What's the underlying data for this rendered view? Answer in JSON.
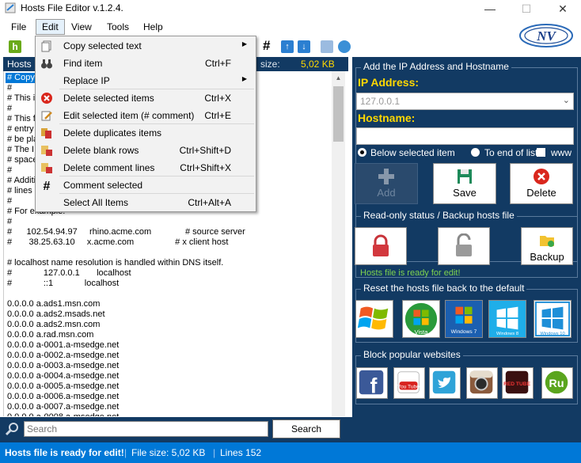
{
  "window": {
    "title": "Hosts File Editor v.1.2.4.",
    "minimize_glyph": "—",
    "maximize_glyph": "☐",
    "close_glyph": "✕"
  },
  "menubar": {
    "file": "File",
    "edit": "Edit",
    "view": "View",
    "tools": "Tools",
    "help": "Help"
  },
  "logo": {
    "text": "NV"
  },
  "edit_menu": {
    "items": [
      {
        "label": "Copy selected text",
        "shortcut": "",
        "submenu": true,
        "icon": "copy-icon"
      },
      {
        "label": "Find item",
        "shortcut": "Ctrl+F",
        "submenu": false,
        "icon": "binoculars-icon"
      },
      {
        "label": "Replace IP",
        "shortcut": "",
        "submenu": true,
        "icon": ""
      },
      {
        "label": "Delete selected items",
        "shortcut": "Ctrl+X",
        "submenu": false,
        "icon": "delete-icon"
      },
      {
        "label": "Edit selected item (# comment)",
        "shortcut": "Ctrl+E",
        "submenu": false,
        "icon": "edit-icon"
      },
      {
        "label": "Delete duplicates items",
        "shortcut": "",
        "submenu": false,
        "icon": "duplicates-icon"
      },
      {
        "label": "Delete blank rows",
        "shortcut": "Ctrl+Shift+D",
        "submenu": false,
        "icon": "blank-rows-icon"
      },
      {
        "label": "Delete comment lines",
        "shortcut": "Ctrl+Shift+X",
        "submenu": false,
        "icon": "comment-lines-icon"
      },
      {
        "label": "Comment selected",
        "shortcut": "",
        "submenu": false,
        "icon": "hash-icon"
      },
      {
        "label": "Select All Items",
        "shortcut": "Ctrl+Alt+A",
        "submenu": false,
        "icon": ""
      }
    ]
  },
  "toolbar": {
    "h_label": "h",
    "hash_label": "#",
    "up_label": "↑",
    "down_label": "↓"
  },
  "editor": {
    "tab_label": "Hosts",
    "filesize_label": "size:",
    "filesize_value": "5,02 KB",
    "lines": [
      "# Copy",
      "#",
      "# This i                                                                  ws.",
      "#",
      "# This f                                                                  ach",
      "# entry",
      "# be pla                                                                 e.",
      "# The I                                                                    st one",
      "# space",
      "#",
      "# Additi                                                                  ual",
      "# lines",
      "#",
      "# For example:",
      "#",
      "#      102.54.94.97     rhino.acme.com              # source server",
      "#       38.25.63.10     x.acme.com                 # x client host",
      "",
      "# localhost name resolution is handled within DNS itself.",
      "#             127.0.0.1       localhost",
      "#             ::1             localhost",
      "",
      "0.0.0.0 a.ads1.msn.com",
      "0.0.0.0 a.ads2.msads.net",
      "0.0.0.0 a.ads2.msn.com",
      "0.0.0.0 a.rad.msn.com",
      "0.0.0.0 a-0001.a-msedge.net",
      "0.0.0.0 a-0002.a-msedge.net",
      "0.0.0.0 a-0003.a-msedge.net",
      "0.0.0.0 a-0004.a-msedge.net",
      "0.0.0.0 a-0005.a-msedge.net",
      "0.0.0.0 a-0006.a-msedge.net",
      "0.0.0.0 a-0007.a-msedge.net",
      "0.0.0.0 a-0008.a-msedge.net"
    ]
  },
  "search": {
    "placeholder": "Search",
    "button_label": "Search"
  },
  "add_panel": {
    "group_title": "Add the IP Address  and Hostname",
    "ip_label": "IP Address:",
    "ip_value": "127.0.0.1",
    "hostname_label": "Hostname:",
    "hostname_value": "",
    "opt_below": "Below selected item",
    "opt_end": "To end of list",
    "opt_www": "www",
    "add_label": "Add",
    "save_label": "Save",
    "delete_label": "Delete"
  },
  "readonly_panel": {
    "group_title": "Read-only status / Backup hosts file",
    "backup_label": "Backup",
    "status": "Hosts file is ready for edit!"
  },
  "reset_panel": {
    "group_title": "Reset the hosts file back to the default",
    "os_items": [
      "Windows XP",
      "Windows Vista",
      "Windows 7",
      "Windows 8",
      "Windows 10"
    ],
    "vista_text": "Vista",
    "win7_text": "Windows 7",
    "win8_text": "Windows 8",
    "win10_text": "Windows 10"
  },
  "block_panel": {
    "group_title": "Block popular websites",
    "sites": [
      "Facebook",
      "YouTube",
      "Twitter",
      "Instagram",
      "RedTube",
      "Ru"
    ],
    "fb_text": "f",
    "yt_text": "You Tube",
    "rt_text": "RED TUBE",
    "ru_text": "Ru"
  },
  "statusbar": {
    "message": "Hosts file is ready for edit!",
    "sep": "|",
    "size": "File size:  5,02 KB",
    "lines": "Lines 152"
  },
  "colors": {
    "panel_bg": "#123a63",
    "accent_yellow": "#ffd800",
    "status_blue": "#0078d7",
    "ready_green": "#7fd34f"
  }
}
